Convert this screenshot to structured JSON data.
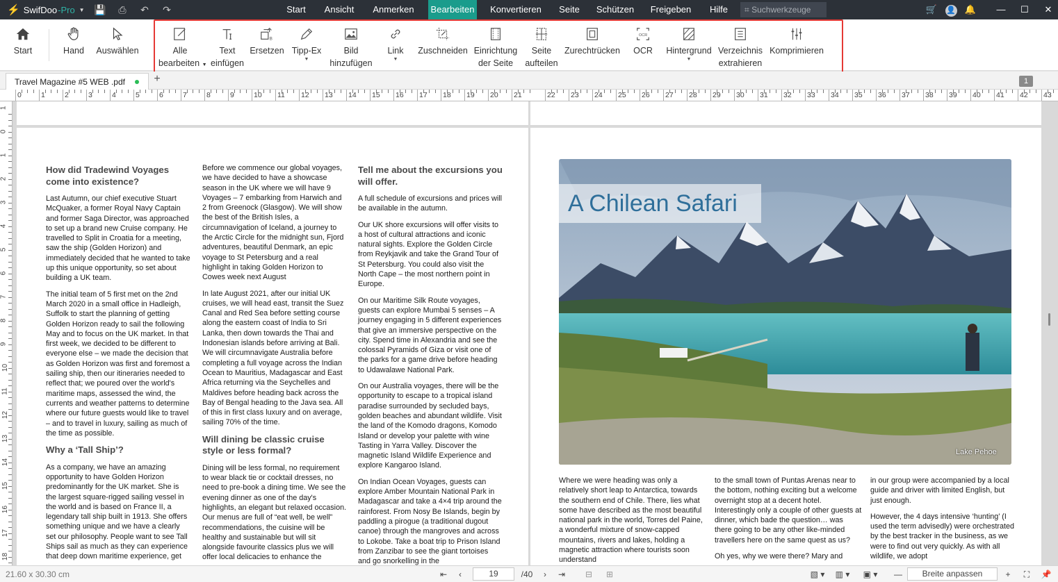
{
  "app": {
    "name": "SwifDoo",
    "name_suffix": "-Pro"
  },
  "menu": [
    "Start",
    "Ansicht",
    "Anmerken",
    "Bearbeiten",
    "Konvertieren",
    "Seite",
    "Schützen",
    "Freigeben",
    "Hilfe"
  ],
  "search_tools": "Suchwerkzeuge",
  "toolbar": {
    "left": [
      {
        "icon": "home-icon",
        "label": "Start"
      },
      {
        "icon": "hand-icon",
        "label": "Hand"
      },
      {
        "icon": "cursor-icon",
        "label": "Auswählen"
      }
    ],
    "edit": [
      {
        "icon": "edit-all-icon",
        "l1": "Alle",
        "l2": "bearbeiten"
      },
      {
        "icon": "text-icon",
        "l1": "Text",
        "l2": "einfügen"
      },
      {
        "icon": "replace-icon",
        "l1": "Ersetzen",
        "l2": ""
      },
      {
        "icon": "pen-icon",
        "l1": "Tipp-Ex",
        "l2": ""
      },
      {
        "icon": "image-icon",
        "l1": "Bild",
        "l2": "hinzufügen"
      },
      {
        "icon": "link-icon",
        "l1": "Link",
        "l2": ""
      },
      {
        "icon": "crop-icon",
        "l1": "Zuschneiden",
        "l2": ""
      },
      {
        "icon": "page-setup-icon",
        "l1": "Einrichtung",
        "l2": "der Seite"
      },
      {
        "icon": "split-page-icon",
        "l1": "Seite",
        "l2": "aufteilen"
      },
      {
        "icon": "deskew-icon",
        "l1": "Zurechtrücken",
        "l2": ""
      },
      {
        "icon": "ocr-icon",
        "l1": "OCR",
        "l2": ""
      },
      {
        "icon": "background-icon",
        "l1": "Hintergrund",
        "l2": ""
      },
      {
        "icon": "extract-toc-icon",
        "l1": "Verzeichnis",
        "l2": "extrahieren"
      },
      {
        "icon": "compress-icon",
        "l1": "Komprimieren",
        "l2": ""
      }
    ]
  },
  "ocr_icon_text": "OCR",
  "tab": {
    "filename": "Travel Magazine  #5 WEB .pdf",
    "add": "+",
    "page_badge": "1"
  },
  "ruler": {
    "h": [
      "0",
      "1",
      "2",
      "3",
      "4",
      "5",
      "6",
      "7",
      "8",
      "9",
      "10",
      "11",
      "12",
      "13",
      "14",
      "15",
      "16",
      "17",
      "18",
      "19",
      "20",
      "21",
      "22",
      "23",
      "24",
      "25",
      "26",
      "27",
      "28",
      "29",
      "30",
      "31",
      "32",
      "33",
      "34",
      "35",
      "36",
      "37",
      "38",
      "39",
      "40",
      "41",
      "42",
      "43"
    ],
    "v": [
      "1",
      "0",
      "1",
      "2",
      "3",
      "4",
      "5",
      "6",
      "7",
      "8",
      "9",
      "10",
      "11",
      "12",
      "13",
      "14",
      "15",
      "16",
      "17",
      "18"
    ]
  },
  "article": {
    "c1": [
      {
        "h": "How did Tradewind Voyages come into existence?"
      },
      {
        "p": "Last Autumn, our chief executive Stuart McQuaker, a former Royal Navy Captain and former Saga Director, was approached to set up a brand new Cruise company. He travelled to Split in Croatia for a meeting, saw the ship (Golden Horizon) and immediately decided that he wanted to take up this unique opportunity, so set about building a UK team."
      },
      {
        "p": "The initial team of 5 first met on the 2nd March 2020 in a small office in Hadleigh, Suffolk to start the planning of getting Golden Horizon ready to sail the following May and to focus on the UK market. In that first week, we decided to be different to everyone else – we made the decision that as Golden Horizon was first and foremost a sailing ship, then our itineraries needed to reflect that; we poured over the world's maritime maps, assessed the wind, the currents and weather patterns to determine where our future guests would like to travel – and to travel in luxury, sailing as much of the time as possible."
      },
      {
        "h": "Why a ‘Tall Ship’?"
      },
      {
        "p": "As a company, we have an amazing opportunity to have Golden Horizon predominantly for the UK market. She is the largest square-rigged sailing vessel in the world and is based on France II, a legendary tall ship built in 1913. She offers something unique and we have a clearly set our philosophy. People want to see Tall Ships sail as much as they can experience that deep down maritime experience, get"
      }
    ],
    "c2": [
      {
        "p": "Before we commence our global voyages, we have decided to have a showcase season in the UK where we will have 9 Voyages – 7 embarking from Harwich and 2 from Greenock (Glasgow). We will show the best of the British Isles, a circumnavigation of Iceland, a journey to the Arctic Circle for the midnight sun, Fjord adventures, beautiful Denmark, an epic voyage to St Petersburg and a real highlight in taking Golden Horizon to Cowes week next August"
      },
      {
        "p": "In late August 2021, after our initial UK cruises, we will head east, transit the Suez Canal and Red Sea before setting course along the eastern coast of India to Sri Lanka, then down towards the Thai and Indonesian islands before arriving at Bali. We will circumnavigate Australia before completing a full voyage across the Indian Ocean to Mauritius, Madagascar and East Africa returning via the Seychelles and Maldives before heading back across the Bay of Bengal heading to the Java sea. All of this in first class luxury and on average, sailing 70% of the time."
      },
      {
        "h": "Will dining be classic cruise style or less formal?"
      },
      {
        "p": "Dining will be less formal, no requirement to wear black tie or cocktail dresses, no need to pre-book a dining time. We see the evening dinner as one of the day's highlights, an elegant but relaxed occasion. Our menus are full of “eat well, be well” recommendations, the cuisine will be healthy and sustainable but will sit alongside favourite classics plus we will offer local delicacies to enhance the"
      }
    ],
    "c3": [
      {
        "h": "Tell me about the excursions you will offer."
      },
      {
        "p": "A full schedule of excursions and prices will be available in the autumn."
      },
      {
        "p": "Our UK shore excursions will offer visits to a host of cultural attractions and iconic natural sights. Explore the Golden Circle from Reykjavik and take the Grand Tour of St Petersburg. You could also visit the North Cape – the most northern point in Europe."
      },
      {
        "p": "On our Maritime Silk Route voyages, guests can explore Mumbai 5 senses – A journey engaging in 5 different experiences that give an immersive perspective on the city. Spend time in Alexandria and see the colossal Pyramids of Giza or visit one of the parks for a game drive before heading to Udawalawe National Park."
      },
      {
        "p": "On our Australia voyages, there will be the opportunity to escape to a tropical island paradise surrounded by secluded bays, golden beaches and abundant wildlife. Visit the land of the Komodo dragons, Komodo Island or develop your palette with wine Tasting in Yarra Valley. Discover the magnetic Island Wildlife Experience and explore Kangaroo Island."
      },
      {
        "p": "On Indian Ocean Voyages, guests can explore Amber Mountain National Park in Madagascar and take a 4×4 trip around the rainforest. From Nosy Be Islands, begin by paddling a pirogue (a traditional dugout canoe) through the mangroves and across to Lokobe. Take a boat trip to Prison Island from Zanzibar to see the giant tortoises and go snorkelling in the"
      }
    ],
    "safari_title": "A Chilean Safari",
    "photo_caption": "Lake Pehoe",
    "r1": "Where we were heading was only a relatively short leap to Antarctica, towards the southern end of Chile. There, lies what some have described as the most beautiful national park in the world, Torres del Paine, a wonderful mixture of snow-capped mountains, rivers and lakes, holding a magnetic attraction where tourists soon understand",
    "r2a": "to the small town of Puntas Arenas near to the bottom, nothing exciting but a welcome overnight stop at a decent hotel. Interestingly only a couple of other guests at dinner, which bade the question… was there going to be any other like-minded travellers here on the same quest as us?",
    "r2b": "Oh yes, why we were there? Mary and",
    "r3a": "in our group were accompanied by a local guide and driver with limited English, but just enough.",
    "r3b": "However, the 4 days intensive ‘hunting’ (I used the term advisedly) were orchestrated by the best tracker in the business, as we were to find out very quickly. As with all wildlife, we adopt"
  },
  "status": {
    "dimensions": "21.60 x 30.30 cm",
    "page": "19",
    "total": "/40",
    "zoom": "Breite anpassen"
  },
  "colors": {
    "accent": "#1a9c8c",
    "titlebar": "#2c3138",
    "highlight": "#e53935",
    "title_blue": "#2f6f9a"
  }
}
